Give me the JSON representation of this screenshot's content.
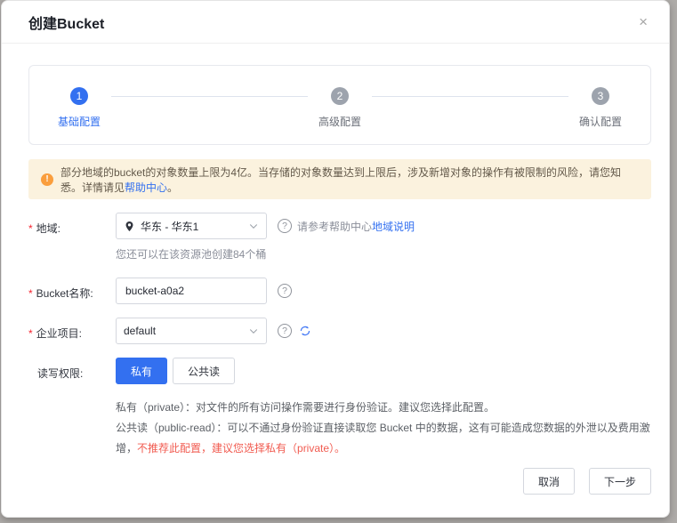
{
  "dialog": {
    "title": "创建Bucket",
    "close_glyph": "×"
  },
  "stepper": {
    "active_step": 1,
    "steps": [
      {
        "num": "1",
        "label": "基础配置"
      },
      {
        "num": "2",
        "label": "高级配置"
      },
      {
        "num": "3",
        "label": "确认配置"
      }
    ]
  },
  "banner": {
    "icon_glyph": "!",
    "text_before_link": "部分地域的bucket的对象数量上限为4亿。当存储的对象数量达到上限后，涉及新增对象的操作有被限制的风险，请您知悉。详情请见",
    "link_text": "帮助中心",
    "text_after_link": "。"
  },
  "form": {
    "required_mark": "*",
    "help_glyph": "?",
    "region": {
      "label": "地域:",
      "value": "华东 - 华东1",
      "help_text": "请参考帮助中心",
      "help_link": "地域说明",
      "note": "您还可以在该资源池创建84个桶"
    },
    "bucket_name": {
      "label": "Bucket名称:",
      "value": "bucket-a0a2"
    },
    "enterprise_project": {
      "label": "企业项目:",
      "value": "default"
    },
    "acl": {
      "label": "读写权限:",
      "options": [
        "私有",
        "公共读"
      ],
      "selected": "私有",
      "private_desc": "私有（private）：对文件的所有访问操作需要进行身份验证。建议您选择此配置。",
      "public_desc": "公共读（public-read）：可以不通过身份验证直接读取您 Bucket 中的数据，这有可能造成您数据的外泄以及费用激增，",
      "public_warning": "不推荐此配置，建议您选择私有（private）。"
    }
  },
  "footer": {
    "cancel_label": "取消",
    "next_label": "下一步"
  },
  "colors": {
    "accent_blue": "#3370f0",
    "link_blue": "#3370f0",
    "warning_text_red": "#f15b50",
    "banner_bg": "#fbf2de",
    "banner_icon_orange": "#fa9e3d",
    "step_inactive_gray": "#9da3ad"
  }
}
